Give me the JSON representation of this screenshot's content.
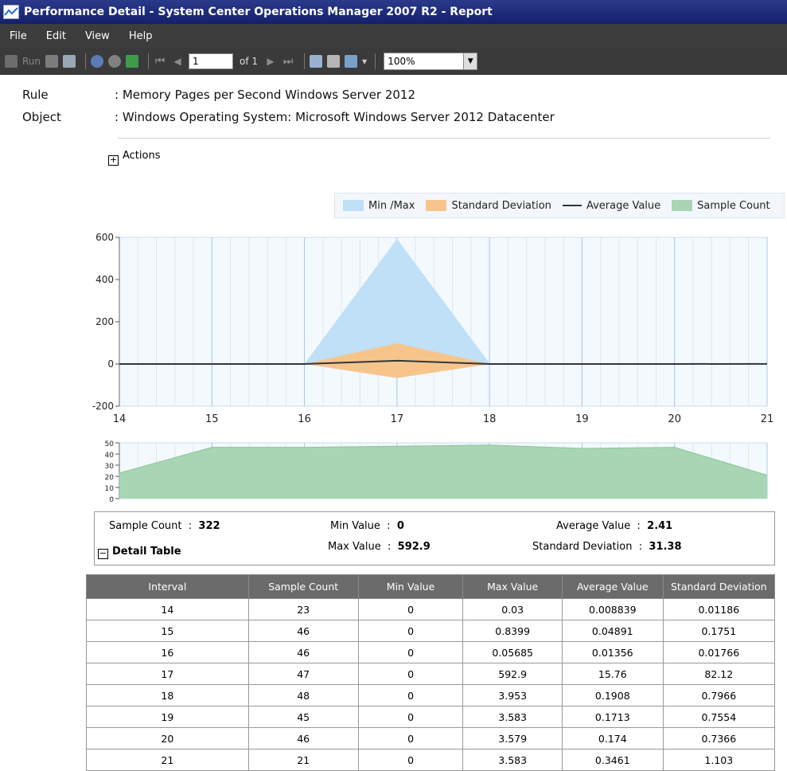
{
  "window": {
    "title": "Performance Detail - System Center Operations Manager 2007 R2 - Report"
  },
  "menu": [
    "File",
    "Edit",
    "View",
    "Help"
  ],
  "toolbar": {
    "run_label": "Run",
    "page_value": "1",
    "page_of": "of 1",
    "zoom_value": "100%"
  },
  "header": {
    "rule_label": "Rule",
    "rule_value": ": Memory Pages per Second Windows Server 2012",
    "object_label": "Object",
    "object_value": ": Windows Operating System: Microsoft Windows Server 2012 Datacenter",
    "actions_label": "Actions",
    "actions_toggle": "+"
  },
  "colors": {
    "minmax": "#bfe0f6",
    "stddev": "#f7c58c",
    "average": "#2f3640",
    "sample": "#a8d5b3",
    "table_header": "#6b6b6b"
  },
  "chart_data": [
    {
      "type": "area",
      "legend": [
        "Min /Max",
        "Standard Deviation",
        "Average Value",
        "Sample Count"
      ],
      "x": [
        14,
        15,
        16,
        17,
        18,
        19,
        20,
        21
      ],
      "xlim": [
        14,
        21
      ],
      "ylim": [
        -200,
        600
      ],
      "yticks": [
        600,
        400,
        200,
        0,
        -200
      ],
      "series": [
        {
          "name": "Min /Max",
          "min": [
            0,
            0,
            0,
            0,
            0,
            0,
            0,
            0
          ],
          "max": [
            0.03,
            0.8399,
            0.05685,
            592.9,
            3.953,
            3.583,
            3.579,
            3.583
          ]
        },
        {
          "name": "Standard Deviation",
          "low": [
            -0.003,
            -0.126,
            -0.004,
            -66.36,
            -0.606,
            -0.584,
            -0.563,
            -0.757
          ],
          "high": [
            0.021,
            0.224,
            0.031,
            97.88,
            0.987,
            0.927,
            0.911,
            1.449
          ]
        },
        {
          "name": "Average Value",
          "values": [
            0.008839,
            0.04891,
            0.01356,
            15.76,
            0.1908,
            0.1713,
            0.174,
            0.3461
          ]
        }
      ]
    },
    {
      "type": "area",
      "x": [
        14,
        15,
        16,
        17,
        18,
        19,
        20,
        21
      ],
      "xlim": [
        14,
        21
      ],
      "ylim": [
        0,
        50
      ],
      "yticks": [
        50,
        40,
        30,
        20,
        10,
        0
      ],
      "series": [
        {
          "name": "Sample Count",
          "values": [
            23,
            46,
            46,
            47,
            48,
            45,
            46,
            21
          ]
        }
      ]
    }
  ],
  "summary": {
    "sample_count_label": "Sample Count",
    "sample_count_value": "322",
    "min_label": "Min Value",
    "min_value": "0",
    "max_label": "Max Value",
    "max_value": "592.9",
    "avg_label": "Average Value",
    "avg_value": "2.41",
    "sd_label": "Standard Deviation",
    "sd_value": "31.38",
    "detail_table_label": "Detail Table",
    "detail_toggle": "−"
  },
  "table": {
    "headers": [
      "Interval",
      "Sample Count",
      "Min Value",
      "Max Value",
      "Average Value",
      "Standard Deviation"
    ],
    "rows": [
      [
        "14",
        "23",
        "0",
        "0.03",
        "0.008839",
        "0.01186"
      ],
      [
        "15",
        "46",
        "0",
        "0.8399",
        "0.04891",
        "0.1751"
      ],
      [
        "16",
        "46",
        "0",
        "0.05685",
        "0.01356",
        "0.01766"
      ],
      [
        "17",
        "47",
        "0",
        "592.9",
        "15.76",
        "82.12"
      ],
      [
        "18",
        "48",
        "0",
        "3.953",
        "0.1908",
        "0.7966"
      ],
      [
        "19",
        "45",
        "0",
        "3.583",
        "0.1713",
        "0.7554"
      ],
      [
        "20",
        "46",
        "0",
        "3.579",
        "0.174",
        "0.7366"
      ],
      [
        "21",
        "21",
        "0",
        "3.583",
        "0.3461",
        "1.103"
      ]
    ]
  }
}
